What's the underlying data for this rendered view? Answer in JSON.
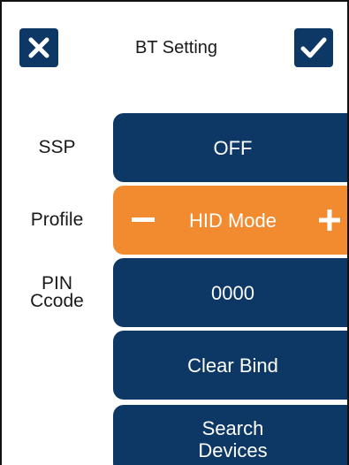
{
  "header": {
    "title": "BT Setting",
    "close_icon": "close-icon",
    "confirm_icon": "check-icon"
  },
  "rows": {
    "ssp": {
      "label": "SSP",
      "value": "OFF"
    },
    "profile": {
      "label": "Profile",
      "value": "HID Mode",
      "decrease_icon": "minus-icon",
      "increase_icon": "plus-icon"
    },
    "pin": {
      "label_line1": "PIN",
      "label_line2": "Ccode",
      "value": "0000"
    },
    "clear_bind": {
      "label": "Clear Bind"
    },
    "search": {
      "label_line1": "Search",
      "label_line2": "Devices"
    }
  },
  "colors": {
    "primary": "#0d3866",
    "accent": "#f28b2f",
    "text": "#1a1a1a"
  }
}
